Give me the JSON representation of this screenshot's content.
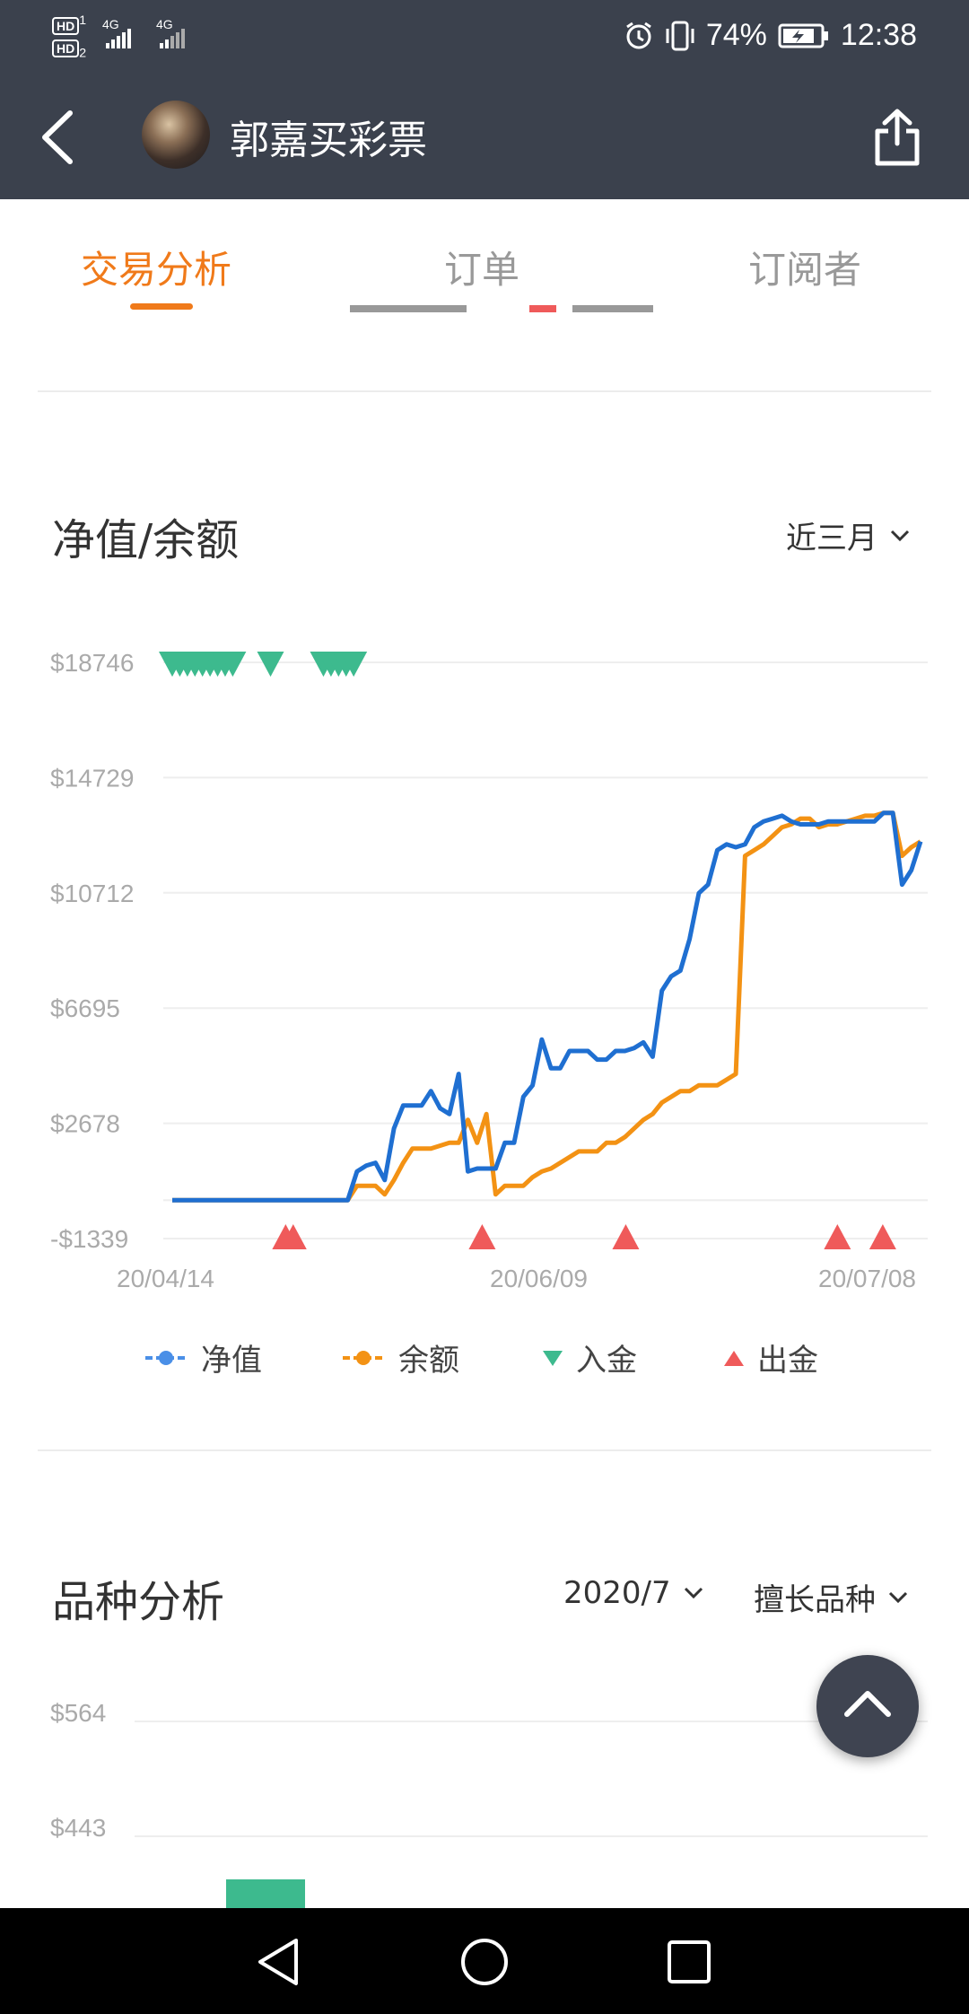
{
  "status_bar": {
    "left": {
      "hd1": "HD",
      "hd1_sub": "1",
      "hd2": "HD",
      "hd2_sub": "2",
      "net1": "4G",
      "net2": "4G"
    },
    "battery": "74%",
    "time": "12:38"
  },
  "header": {
    "title": "郭嘉买彩票"
  },
  "tabs": [
    {
      "label": "交易分析",
      "active": true
    },
    {
      "label": "订单",
      "active": false
    },
    {
      "label": "订阅者",
      "active": false
    }
  ],
  "net_value_section": {
    "title": "净值/余额",
    "range_dropdown": "近三月"
  },
  "chart_data": {
    "type": "line",
    "title": "净值/余额",
    "y_ticks": [
      "$18746",
      "$14729",
      "$10712",
      "$6695",
      "$2678",
      "-$1339"
    ],
    "ylim": [
      -1339,
      18746
    ],
    "x_ticks": [
      "20/04/14",
      "20/06/09",
      "20/07/08"
    ],
    "series": [
      {
        "name": "净值",
        "color": "#1f6fd1",
        "values": [
          0,
          0,
          0,
          0,
          0,
          0,
          0,
          0,
          0,
          0,
          0,
          0,
          0,
          0,
          0,
          0,
          0,
          0,
          0,
          0,
          1000,
          1200,
          1300,
          700,
          2500,
          3300,
          3300,
          3300,
          3800,
          3200,
          3000,
          4400,
          1000,
          1100,
          1100,
          1100,
          2000,
          2000,
          3600,
          4000,
          5600,
          4600,
          4600,
          5200,
          5200,
          5200,
          4900,
          4900,
          5200,
          5200,
          5300,
          5500,
          5000,
          7300,
          7800,
          8000,
          9100,
          10700,
          11000,
          12200,
          12400,
          12300,
          12400,
          13000,
          13200,
          13300,
          13400,
          13200,
          13100,
          13100,
          13100,
          13200,
          13200,
          13200,
          13200,
          13200,
          13200,
          13500,
          13500,
          11000,
          11500,
          12500
        ]
      },
      {
        "name": "余额",
        "color": "#f39214",
        "values": [
          0,
          0,
          0,
          0,
          0,
          0,
          0,
          0,
          0,
          0,
          0,
          0,
          0,
          0,
          0,
          0,
          0,
          0,
          0,
          0,
          500,
          500,
          500,
          200,
          700,
          1300,
          1800,
          1800,
          1800,
          1900,
          2000,
          2000,
          2800,
          2000,
          3000,
          200,
          500,
          500,
          500,
          800,
          1000,
          1100,
          1300,
          1500,
          1700,
          1700,
          1700,
          2000,
          2000,
          2200,
          2500,
          2800,
          3000,
          3400,
          3600,
          3800,
          3800,
          4000,
          4000,
          4000,
          4200,
          4400,
          12000,
          12200,
          12400,
          12700,
          13000,
          13100,
          13300,
          13300,
          13000,
          13100,
          13100,
          13200,
          13300,
          13400,
          13400,
          13500,
          13500,
          12000,
          12300,
          12500
        ]
      },
      {
        "name": "入金",
        "color": "#3dba8e",
        "marker": "triangle-down",
        "x_positions_index": [
          0,
          1,
          2,
          3,
          4,
          5,
          6,
          7,
          8,
          13,
          20,
          21,
          22,
          23,
          24
        ]
      },
      {
        "name": "出金",
        "color": "#ef5a5a",
        "marker": "triangle-up",
        "x_positions_index": [
          15,
          16,
          41,
          60,
          88,
          94
        ]
      }
    ],
    "legend": [
      {
        "label": "净值",
        "color": "#4a8fe7",
        "kind": "line-dot"
      },
      {
        "label": "余额",
        "color": "#f39214",
        "kind": "line-dot"
      },
      {
        "label": "入金",
        "color": "#3dba8e",
        "kind": "triangle-down"
      },
      {
        "label": "出金",
        "color": "#ef5a5a",
        "kind": "triangle-up"
      }
    ],
    "grid": true
  },
  "variety_section": {
    "title": "品种分析",
    "month_dropdown": "2020/7",
    "type_dropdown": "擅长品种",
    "y_ticks": [
      "$564",
      "$443"
    ],
    "bar_color": "#3dba8e"
  }
}
